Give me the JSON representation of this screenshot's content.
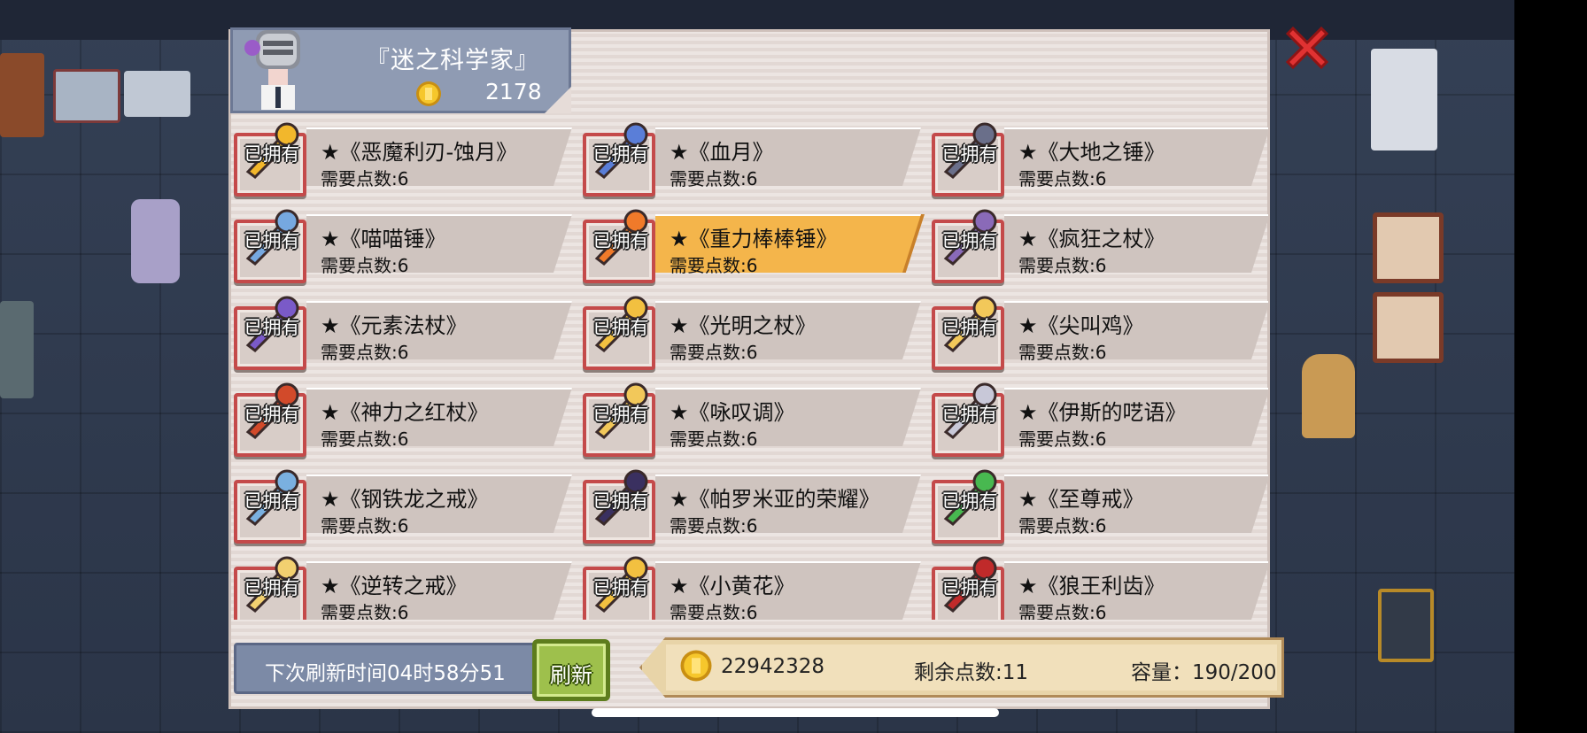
{
  "merchant": {
    "name": "『迷之科学家』",
    "gold": "2178"
  },
  "items": [
    {
      "title": "★《恶魔利刃-蚀月》",
      "req": "需要点数:6",
      "owned": "已拥有",
      "icon": "crescent-blade-icon"
    },
    {
      "title": "★《血月》",
      "req": "需要点数:6",
      "owned": "已拥有",
      "icon": "blue-weapon-icon"
    },
    {
      "title": "★《大地之锤》",
      "req": "需要点数:6",
      "owned": "已拥有",
      "icon": "hammer-icon"
    },
    {
      "title": "★《喵喵锤》",
      "req": "需要点数:6",
      "owned": "已拥有",
      "icon": "cat-hammer-icon"
    },
    {
      "title": "★《重力棒棒锤》",
      "req": "需要点数:6",
      "owned": "已拥有",
      "icon": "lollipop-hammer-icon",
      "selected": true
    },
    {
      "title": "★《疯狂之杖》",
      "req": "需要点数:6",
      "owned": "已拥有",
      "icon": "dark-staff-icon"
    },
    {
      "title": "★《元素法杖》",
      "req": "需要点数:6",
      "owned": "已拥有",
      "icon": "elemental-staff-icon"
    },
    {
      "title": "★《光明之杖》",
      "req": "需要点数:6",
      "owned": "已拥有",
      "icon": "sun-staff-icon"
    },
    {
      "title": "★《尖叫鸡》",
      "req": "需要点数:6",
      "owned": "已拥有",
      "icon": "rubber-chicken-icon"
    },
    {
      "title": "★《神力之红杖》",
      "req": "需要点数:6",
      "owned": "已拥有",
      "icon": "red-staff-icon"
    },
    {
      "title": "★《咏叹调》",
      "req": "需要点数:6",
      "owned": "已拥有",
      "icon": "winged-staff-icon"
    },
    {
      "title": "★《伊斯的呓语》",
      "req": "需要点数:6",
      "owned": "已拥有",
      "icon": "claw-weapon-icon"
    },
    {
      "title": "★《钢铁龙之戒》",
      "req": "需要点数:6",
      "owned": "已拥有",
      "icon": "dragon-ring-icon"
    },
    {
      "title": "★《帕罗米亚的荣耀》",
      "req": "需要点数:6",
      "owned": "已拥有",
      "icon": "glory-ring-icon"
    },
    {
      "title": "★《至尊戒》",
      "req": "需要点数:6",
      "owned": "已拥有",
      "icon": "emerald-ring-icon"
    },
    {
      "title": "★《逆转之戒》",
      "req": "需要点数:6",
      "owned": "已拥有",
      "icon": "reverse-ring-icon"
    },
    {
      "title": "★《小黄花》",
      "req": "需要点数:6",
      "owned": "已拥有",
      "icon": "flower-ring-icon"
    },
    {
      "title": "★《狼王利齿》",
      "req": "需要点数:6",
      "owned": "已拥有",
      "icon": "wolf-fang-icon"
    }
  ],
  "footer": {
    "refresh_time": "下次刷新时间04时58分51",
    "refresh_button": "刷新",
    "money": "22942328",
    "points": "剩余点数:11",
    "capacity": "容量：190/200"
  },
  "colors": {
    "selected_bar": "#f4b54b",
    "owned_frame": "#c44a4a",
    "refresh_button": "#9ec04c",
    "close_icon": "#e03232"
  }
}
